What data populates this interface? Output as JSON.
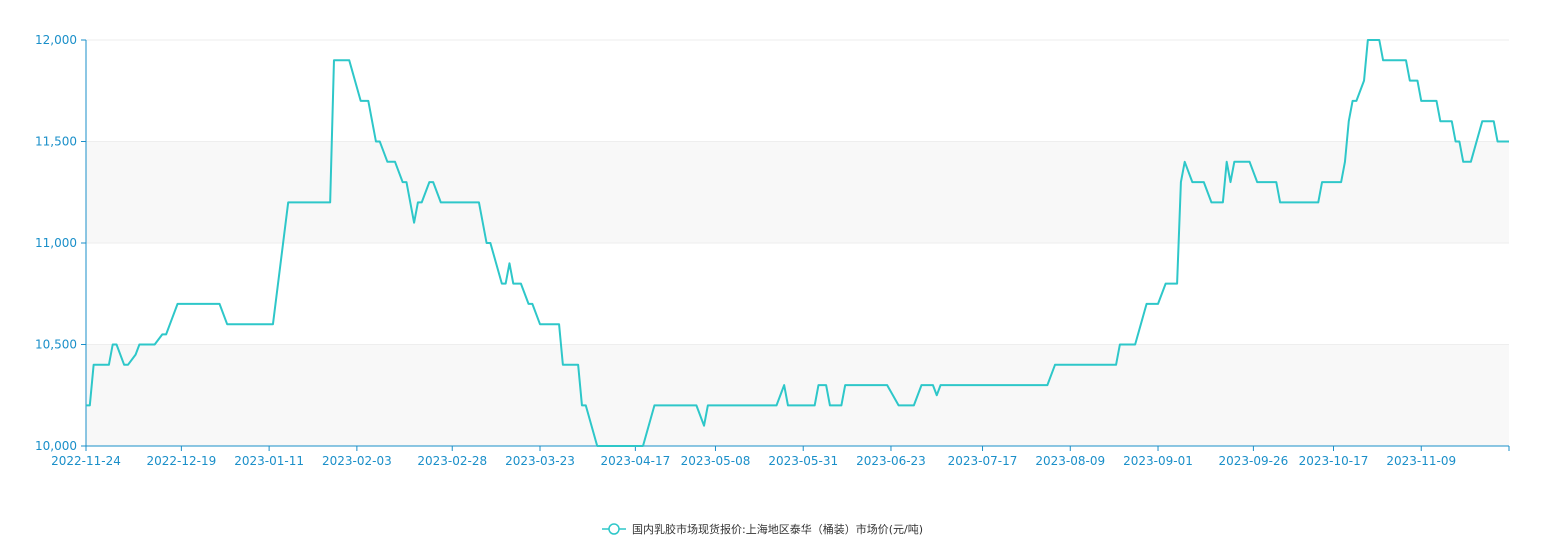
{
  "chart_data": {
    "type": "line",
    "colors": {
      "line": "#2ec7c9",
      "axis": "#1a8fc9",
      "band": "#f8f8f8",
      "grid": "#eeeeee"
    },
    "ylim": [
      10000,
      12000
    ],
    "y_ticks": [
      10000,
      10500,
      11000,
      11500,
      12000
    ],
    "y_tick_labels": [
      "10,000",
      "10,500",
      "11,000",
      "11,500",
      "12,000"
    ],
    "x_tick_labels": [
      "2022-11-24",
      "2022-12-19",
      "2023-01-11",
      "2023-02-03",
      "2023-02-28",
      "2023-03-23",
      "2023-04-17",
      "2023-05-08",
      "2023-05-31",
      "2023-06-23",
      "2023-07-17",
      "2023-08-09",
      "2023-09-01",
      "2023-09-26",
      "2023-10-17",
      "2023-11-09"
    ],
    "legend_position": "bottom-center",
    "series": [
      {
        "name": "国内乳胶市场现货报价:上海地区泰华（桶装）市场价(元/吨)",
        "points": [
          [
            "2022-11-24",
            10200
          ],
          [
            "2022-11-25",
            10200
          ],
          [
            "2022-11-26",
            10400
          ],
          [
            "2022-11-30",
            10400
          ],
          [
            "2022-12-01",
            10500
          ],
          [
            "2022-12-02",
            10500
          ],
          [
            "2022-12-04",
            10400
          ],
          [
            "2022-12-05",
            10400
          ],
          [
            "2022-12-07",
            10450
          ],
          [
            "2022-12-08",
            10500
          ],
          [
            "2022-12-12",
            10500
          ],
          [
            "2022-12-14",
            10550
          ],
          [
            "2022-12-15",
            10550
          ],
          [
            "2022-12-16",
            10600
          ],
          [
            "2022-12-18",
            10700
          ],
          [
            "2022-12-29",
            10700
          ],
          [
            "2022-12-31",
            10600
          ],
          [
            "2023-01-12",
            10600
          ],
          [
            "2023-01-16",
            11200
          ],
          [
            "2023-01-27",
            11200
          ],
          [
            "2023-01-28",
            11900
          ],
          [
            "2023-02-01",
            11900
          ],
          [
            "2023-02-04",
            11700
          ],
          [
            "2023-02-06",
            11700
          ],
          [
            "2023-02-08",
            11500
          ],
          [
            "2023-02-09",
            11500
          ],
          [
            "2023-02-11",
            11400
          ],
          [
            "2023-02-13",
            11400
          ],
          [
            "2023-02-15",
            11300
          ],
          [
            "2023-02-16",
            11300
          ],
          [
            "2023-02-18",
            11100
          ],
          [
            "2023-02-19",
            11200
          ],
          [
            "2023-02-20",
            11200
          ],
          [
            "2023-02-22",
            11300
          ],
          [
            "2023-02-23",
            11300
          ],
          [
            "2023-02-25",
            11200
          ],
          [
            "2023-03-07",
            11200
          ],
          [
            "2023-03-09",
            11000
          ],
          [
            "2023-03-10",
            11000
          ],
          [
            "2023-03-13",
            10800
          ],
          [
            "2023-03-14",
            10800
          ],
          [
            "2023-03-15",
            10900
          ],
          [
            "2023-03-16",
            10800
          ],
          [
            "2023-03-18",
            10800
          ],
          [
            "2023-03-20",
            10700
          ],
          [
            "2023-03-21",
            10700
          ],
          [
            "2023-03-23",
            10600
          ],
          [
            "2023-03-28",
            10600
          ],
          [
            "2023-03-29",
            10400
          ],
          [
            "2023-04-02",
            10400
          ],
          [
            "2023-04-03",
            10200
          ],
          [
            "2023-04-04",
            10200
          ],
          [
            "2023-04-07",
            10000
          ],
          [
            "2023-04-19",
            10000
          ],
          [
            "2023-04-22",
            10200
          ],
          [
            "2023-05-03",
            10200
          ],
          [
            "2023-05-05",
            10100
          ],
          [
            "2023-05-06",
            10200
          ],
          [
            "2023-05-24",
            10200
          ],
          [
            "2023-05-26",
            10300
          ],
          [
            "2023-05-27",
            10200
          ],
          [
            "2023-06-03",
            10200
          ],
          [
            "2023-06-04",
            10300
          ],
          [
            "2023-06-06",
            10300
          ],
          [
            "2023-06-07",
            10200
          ],
          [
            "2023-06-10",
            10200
          ],
          [
            "2023-06-11",
            10300
          ],
          [
            "2023-06-22",
            10300
          ],
          [
            "2023-06-25",
            10200
          ],
          [
            "2023-06-29",
            10200
          ],
          [
            "2023-07-01",
            10300
          ],
          [
            "2023-07-04",
            10300
          ],
          [
            "2023-07-05",
            10250
          ],
          [
            "2023-07-06",
            10300
          ],
          [
            "2023-08-03",
            10300
          ],
          [
            "2023-08-05",
            10400
          ],
          [
            "2023-08-21",
            10400
          ],
          [
            "2023-08-22",
            10500
          ],
          [
            "2023-08-26",
            10500
          ],
          [
            "2023-08-29",
            10700
          ],
          [
            "2023-09-01",
            10700
          ],
          [
            "2023-09-03",
            10800
          ],
          [
            "2023-09-06",
            10800
          ],
          [
            "2023-09-07",
            11300
          ],
          [
            "2023-09-08",
            11400
          ],
          [
            "2023-09-10",
            11300
          ],
          [
            "2023-09-13",
            11300
          ],
          [
            "2023-09-15",
            11200
          ],
          [
            "2023-09-18",
            11200
          ],
          [
            "2023-09-19",
            11400
          ],
          [
            "2023-09-20",
            11300
          ],
          [
            "2023-09-21",
            11400
          ],
          [
            "2023-09-25",
            11400
          ],
          [
            "2023-09-27",
            11300
          ],
          [
            "2023-10-02",
            11300
          ],
          [
            "2023-10-03",
            11200
          ],
          [
            "2023-10-13",
            11200
          ],
          [
            "2023-10-14",
            11300
          ],
          [
            "2023-10-19",
            11300
          ],
          [
            "2023-10-20",
            11400
          ],
          [
            "2023-10-21",
            11600
          ],
          [
            "2023-10-22",
            11700
          ],
          [
            "2023-10-23",
            11700
          ],
          [
            "2023-10-25",
            11800
          ],
          [
            "2023-10-26",
            12000
          ],
          [
            "2023-10-29",
            12000
          ],
          [
            "2023-10-30",
            11900
          ],
          [
            "2023-11-05",
            11900
          ],
          [
            "2023-11-06",
            11800
          ],
          [
            "2023-11-08",
            11800
          ],
          [
            "2023-11-09",
            11700
          ],
          [
            "2023-11-13",
            11700
          ],
          [
            "2023-11-14",
            11600
          ],
          [
            "2023-11-17",
            11600
          ],
          [
            "2023-11-18",
            11500
          ],
          [
            "2023-11-19",
            11500
          ],
          [
            "2023-11-20",
            11400
          ],
          [
            "2023-11-22",
            11400
          ],
          [
            "2023-11-25",
            11600
          ],
          [
            "2023-11-28",
            11600
          ],
          [
            "2023-11-29",
            11500
          ],
          [
            "2023-12-02",
            11500
          ]
        ]
      }
    ]
  }
}
